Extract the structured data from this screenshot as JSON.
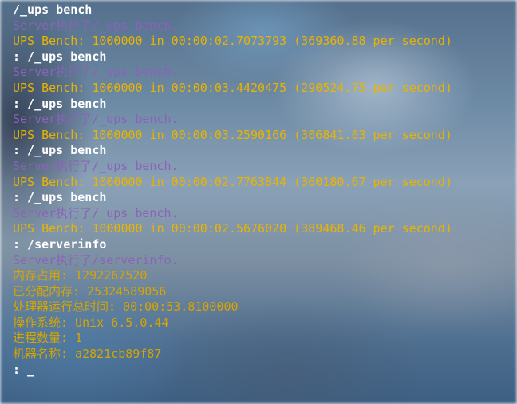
{
  "terminal": {
    "lines": [
      {
        "type": "cmd",
        "text": "/_ups bench"
      },
      {
        "type": "server",
        "text": "Server执行了/_ups bench."
      },
      {
        "type": "ups",
        "text": "UPS Bench: 1000000 in 00:00:02.7073793 (369360.88 per second)"
      },
      {
        "type": "cmd",
        "text": ": /_ups bench"
      },
      {
        "type": "server",
        "text": "Server执行了/_ups bench."
      },
      {
        "type": "ups",
        "text": "UPS Bench: 1000000 in 00:00:03.4420475 (290524.75 per second)"
      },
      {
        "type": "cmd",
        "text": ": /_ups bench"
      },
      {
        "type": "server",
        "text": "Server执行了/_ups bench."
      },
      {
        "type": "ups",
        "text": "UPS Bench: 1000000 in 00:00:03.2590166 (306841.03 per second)"
      },
      {
        "type": "cmd",
        "text": ": /_ups bench"
      },
      {
        "type": "server",
        "text": "Server执行了/_ups bench."
      },
      {
        "type": "ups",
        "text": "UPS Bench: 1000000 in 00:00:02.7763844 (360180.67 per second)"
      },
      {
        "type": "cmd",
        "text": ": /_ups bench"
      },
      {
        "type": "server",
        "text": "Server执行了/_ups bench."
      },
      {
        "type": "ups",
        "text": "UPS Bench: 1000000 in 00:00:02.5676020 (389468.46 per second)"
      },
      {
        "type": "cmd",
        "text": ": /serverinfo"
      },
      {
        "type": "server",
        "text": "Server执行了/serverinfo."
      },
      {
        "type": "info",
        "text": "内存占用: 1292267520"
      },
      {
        "type": "info",
        "text": "已分配内存: 25324589056"
      },
      {
        "type": "info",
        "text": "处理器运行总时间: 00:00:53.8100000"
      },
      {
        "type": "info",
        "text": "操作系统: Unix 6.5.0.44"
      },
      {
        "type": "info",
        "text": "进程数量: 1"
      },
      {
        "type": "info",
        "text": "机器名称: a2821cb89f87"
      }
    ],
    "prompt": ": _"
  },
  "colors": {
    "command": "#ffffff",
    "server_echo": "#8a63b8",
    "ups_result": "#e8b400",
    "info": "#d6a500"
  }
}
